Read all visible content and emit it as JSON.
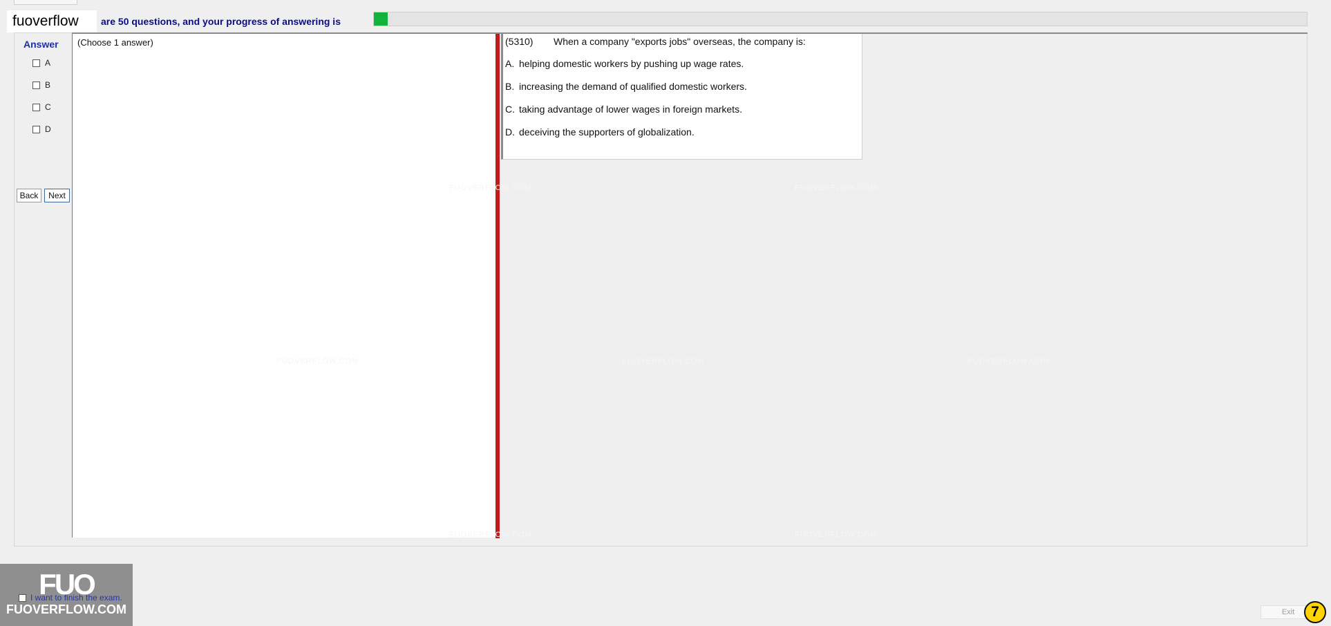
{
  "app": {
    "brand": "fuoverflow"
  },
  "progress": {
    "text": "are 50 questions, and your progress of answering is",
    "fraction": 0.015,
    "fill_color": "#12b33b"
  },
  "answer": {
    "title": "Answer",
    "options": [
      "A",
      "B",
      "C",
      "D"
    ]
  },
  "nav": {
    "back": "Back",
    "next": "Next"
  },
  "answer_pane": {
    "instruction": "(Choose 1 answer)"
  },
  "question": {
    "id": "(5310)",
    "text": "When a company \"exports jobs\" overseas, the company is:",
    "choices": [
      {
        "letter": "A.",
        "text": "helping domestic workers by pushing up wage rates."
      },
      {
        "letter": "B.",
        "text": "increasing the demand of qualified domestic workers."
      },
      {
        "letter": "C.",
        "text": "taking advantage of lower wages in foreign markets."
      },
      {
        "letter": "D.",
        "text": "deceiving the supporters of globalization."
      }
    ]
  },
  "watermarks": {
    "site": "FUOVERFLOW.COM"
  },
  "logo": {
    "main": "FUO",
    "sub": "FUOVERFLOW.COM"
  },
  "footer": {
    "finish_label": "I want to finish the exam.",
    "exit": "Exit",
    "badge": "7"
  },
  "colors": {
    "accent_blue": "#0c0c88",
    "red_splitter": "#c31b1b",
    "badge_yellow": "#ffd400"
  },
  "icons": {
    "checkbox": "checkbox-icon"
  }
}
